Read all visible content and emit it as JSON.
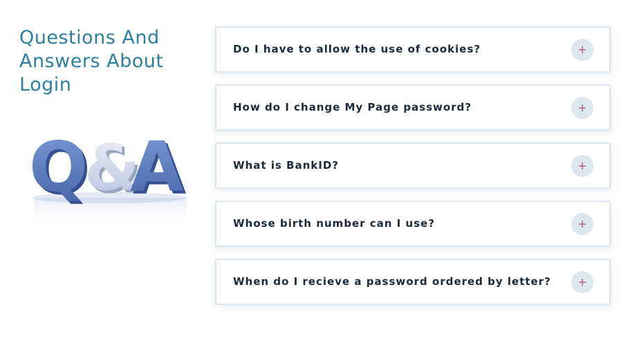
{
  "heading": "Questions And Answers About Login",
  "colors": {
    "heading": "#2e7fa0",
    "question_text": "#1b2a3a",
    "plus_icon": "#b24a73",
    "toggle_bg": "#dde8ee",
    "card_border": "#dbe6ef",
    "qa_letters_dark": "#5b7fc1",
    "qa_letters_light": "#d7dded"
  },
  "illustration": {
    "icon": "qa-letters-image",
    "text": "Q&A"
  },
  "faq": [
    {
      "question": "Do I have to allow the use of cookies?",
      "icon": "plus-icon"
    },
    {
      "question": "How do I change My Page password?",
      "icon": "plus-icon"
    },
    {
      "question": "What is BankID?",
      "icon": "plus-icon"
    },
    {
      "question": "Whose birth number can I use?",
      "icon": "plus-icon"
    },
    {
      "question": "When do I recieve a password ordered by letter?",
      "icon": "plus-icon"
    }
  ]
}
